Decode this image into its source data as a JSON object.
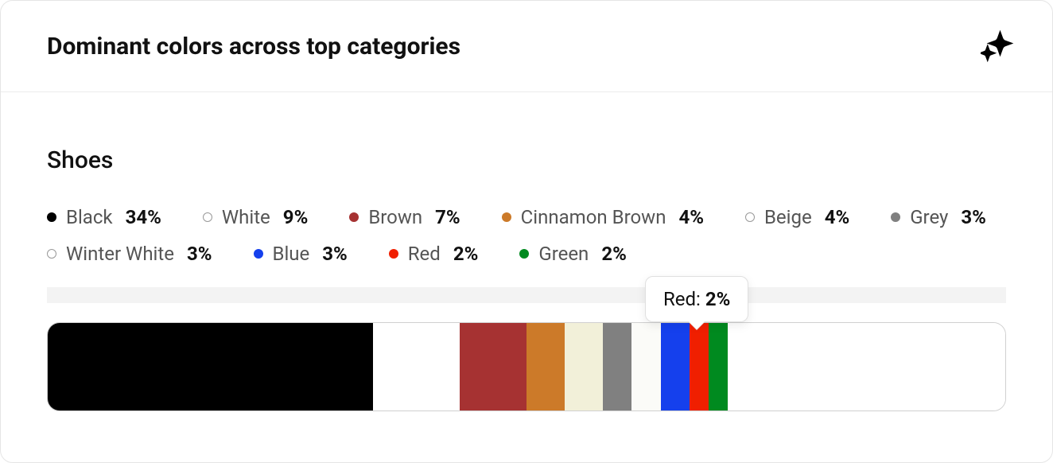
{
  "card": {
    "title": "Dominant colors across top categories"
  },
  "section": {
    "title": "Shoes"
  },
  "chart_data": {
    "type": "bar",
    "title": "Dominant colors across top categories",
    "subtitle": "Shoes",
    "categories": [
      "Black",
      "White",
      "Brown",
      "Cinnamon Brown",
      "Beige",
      "Grey",
      "Winter White",
      "Blue",
      "Red",
      "Green"
    ],
    "values": [
      34,
      9,
      7,
      4,
      4,
      3,
      3,
      3,
      2,
      2
    ],
    "series_colors": [
      "#000000",
      "#ffffff",
      "#a63232",
      "#cc7a29",
      "#f2f0d9",
      "#808080",
      "#fbfbf8",
      "#1540ed",
      "#f01f00",
      "#008a1f"
    ],
    "unit": "%",
    "ylim": [
      0,
      100
    ]
  },
  "legend": [
    {
      "label": "Black",
      "pct": "34%",
      "color": "#000000",
      "hollow": false
    },
    {
      "label": "White",
      "pct": "9%",
      "color": "#ffffff",
      "hollow": true
    },
    {
      "label": "Brown",
      "pct": "7%",
      "color": "#a63232",
      "hollow": false
    },
    {
      "label": "Cinnamon Brown",
      "pct": "4%",
      "color": "#cc7a29",
      "hollow": false
    },
    {
      "label": "Beige",
      "pct": "4%",
      "color": "#f2f0d9",
      "hollow": true
    },
    {
      "label": "Grey",
      "pct": "3%",
      "color": "#808080",
      "hollow": false
    },
    {
      "label": "Winter White",
      "pct": "3%",
      "color": "#fbfbf8",
      "hollow": true
    },
    {
      "label": "Blue",
      "pct": "3%",
      "color": "#1540ed",
      "hollow": false
    },
    {
      "label": "Red",
      "pct": "2%",
      "color": "#f01f00",
      "hollow": false
    },
    {
      "label": "Green",
      "pct": "2%",
      "color": "#008a1f",
      "hollow": false
    }
  ],
  "tooltip": {
    "label": "Red: ",
    "value": "2%"
  }
}
